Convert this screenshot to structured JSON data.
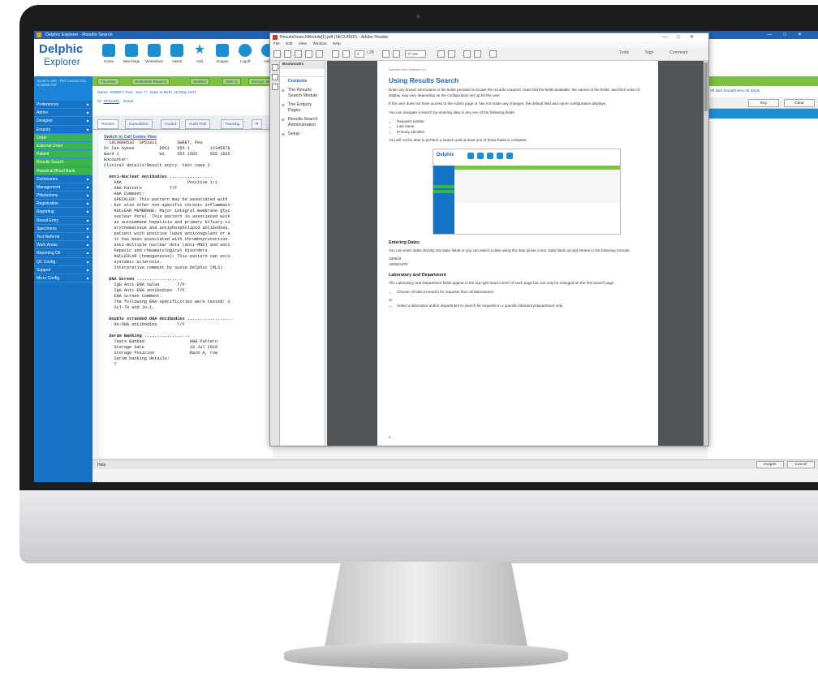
{
  "app": {
    "title": "Delphic Explorer - Results Search",
    "logo_line1": "Delphic",
    "logo_line2": "Explorer",
    "toolbar": [
      "Home",
      "New Page",
      "Worksheet",
      "Attach",
      "Add",
      "Images",
      "Logoff",
      "Help"
    ],
    "user_info": "System user - Ref Central City Hospital Ref",
    "sidebar": [
      "Preferences",
      "Admin",
      "Designer",
      "Enquiry",
      "Order",
      "External Order",
      "Patient",
      "Results Search",
      "Historical Blood Bank",
      "Dictionaries",
      "Management",
      "Phlebotomy",
      "Registration",
      "Reporting",
      "Result Entry",
      "Specimens",
      "Test Referral",
      "Work Areas",
      "Reporting Dtl",
      "QC Config",
      "Support",
      "Micro Config"
    ],
    "fav_tabs": [
      "Favorites",
      "Worksheet Request",
      "Worklist",
      "SMS Q",
      "Encrypt. Wait"
    ],
    "patient": {
      "name_label": "Name",
      "name": "SWEET, Pea",
      "sex_label": "Sex",
      "sex": "F",
      "dob_label": "Date of Birth",
      "dob": "18 May 1971",
      "id_label": "ID",
      "id": "SP51811",
      "event": "Event"
    },
    "result_tabs": [
      "Results",
      "Cumulative",
      "Coded",
      "Audit Trail",
      "Tracking",
      "R"
    ],
    "results_link": "Switch to Call Centre View",
    "results_lines": [
      "  18C0008532  SP51811        SWEET, Pea",
      "Dr Ian Sykes          DOC1   555 1        12345678",
      "Ward 1                W1     555 1565     555 1565",
      "Encounter:",
      "Clinical details:Result entry. test case 2",
      "",
      "  Anti-Nuclear Antibodies .................",
      "    ANA                          Positive 1:1",
      "    ANA Pattern           T/F",
      "    ANA Comment:",
      "    SPECKLED: This pattern may be associated with",
      "    but also other non-specific chronic inflammato",
      "    NUCLEAR MEMBRANE: Major integral membrane glyc",
      "    nuclear Pore). This pattern is associated with",
      "    as autoimmune hepatitis and primary biliary ci",
      "    erythematosus and antiphospholipid antibodies.",
      "    patient with positive lupus anticoagulant or a",
      "    it has been associated with thromboprotection.",
      "    anti-multiple nuclear dots (anti-MND) and anti",
      "    hepatic and rheumatological disorders.",
      "    NUCLEOLAR (homogeneous): This pattern can occu",
      "    systemic sclerosis.",
      "    Interpretive comment by Susie Delphic (MLS)",
      "",
      "  ENA Screen ..................",
      "    IgG Anti-ENA Value       T/F",
      "    IgG Anti-ENA antibodies  T/F",
      "    ENA Screen Comment:",
      "    The following ENA specificities were tested: S",
      "    Scl-70 and Jo-1.",
      "",
      "  Double stranded DNA Antibodies ..................",
      "    ds-DNA antibodies        T/F",
      "",
      "  Serum Banking ..................",
      "    Tests Banked                  ANA Pattern",
      "    Storage Date                  16 Jul 2018",
      "    Storage Position              Rack A, row",
      "    Serum banking details:",
      "    T"
    ],
    "right_links": "All labs   Department   All depts",
    "right_btns": [
      "Key",
      "Clear"
    ],
    "bottom_btns": [
      "Images",
      "Cancel"
    ],
    "status": "Help"
  },
  "adobe": {
    "title": "ResultsSearchModule[1].pdf (SECURED) - Adobe Reader",
    "menu": [
      "File",
      "Edit",
      "View",
      "Window",
      "Help"
    ],
    "page_field": "4",
    "page_total": "/ 28",
    "zoom": "77.4%",
    "tools_right": [
      "Tools",
      "Sign",
      "Comment"
    ],
    "bookmarks_title": "Bookmarks",
    "bookmarks": [
      "Contents",
      "The Results Search Module",
      "The Enquiry Pages",
      "Results Search Administration",
      "Setup"
    ],
    "page": {
      "header": "Sysmex New Zealand Ltd",
      "h1": "Using Results Search",
      "p1": "Enter any known information in the fields provided to locate the records required. Note that the fields available, the names of the fields, and their order of display may vary depending on the configuration set up for the user.",
      "p2": "If the user does not have access to the Admin page or has not made any changes, the default field and name configuration displays.",
      "p3": "You can navigate a search by entering data in any one of the following fields:",
      "list1": [
        "Request number",
        "Last name",
        "Primary identifier"
      ],
      "p4": "You will not be able to perform a search until at least one of these fields is complete.",
      "h2a": "Entering Dates",
      "p5": "You can enter dates directly into Date fields or you can select a date using the date picker icons. Date fields accept entries in the following formats:",
      "dates": [
        "180619",
        "18/06/1978"
      ],
      "h2b": "Laboratory and Department",
      "p6": "The Laboratory and Department fields appear in the top right hand corner of each page but can only be changed on the first search page.",
      "list2a": "Choose All labs to search for requests from all laboratories",
      "or": "or",
      "list2b": "Select a laboratory and/or department to search for requests in a specific laboratory/department only.",
      "page_number": "4",
      "shot_logo": "Delphic"
    }
  }
}
